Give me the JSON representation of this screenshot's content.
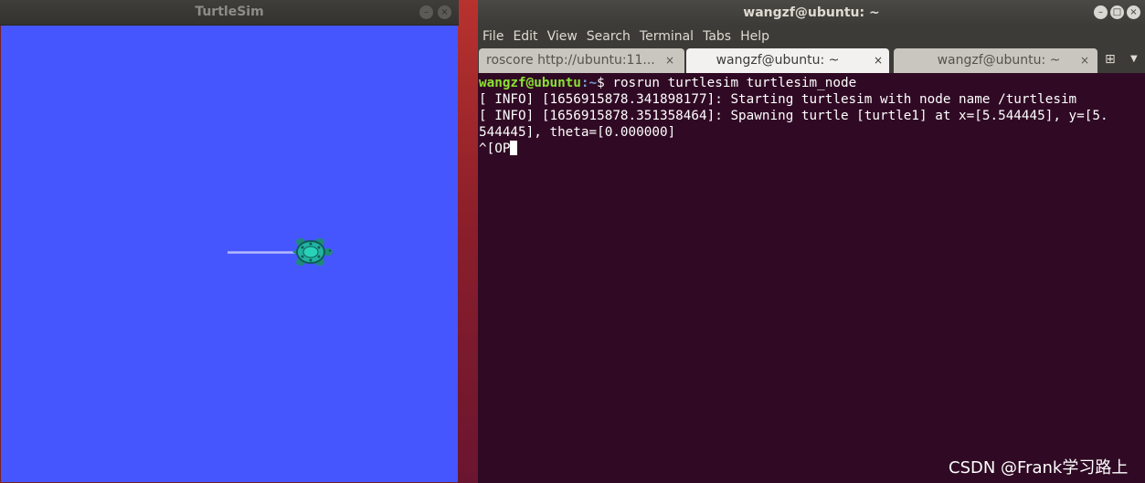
{
  "turtlesim": {
    "title": "TurtleSim",
    "minimize_glyph": "–",
    "close_glyph": "×",
    "background_color": "#4556ff",
    "trail_color": "#b3b8ff"
  },
  "terminal": {
    "title": "wangzf@ubuntu: ~",
    "window_buttons": {
      "minimize": "–",
      "maximize": "□",
      "close": "×"
    },
    "menu": [
      "File",
      "Edit",
      "View",
      "Search",
      "Terminal",
      "Tabs",
      "Help"
    ],
    "tabs": [
      {
        "label": "roscore http://ubuntu:11...",
        "close": "×",
        "active": false
      },
      {
        "label": "wangzf@ubuntu: ~",
        "close": "×",
        "active": true
      },
      {
        "label": "wangzf@ubuntu: ~",
        "close": "×",
        "active": false
      }
    ],
    "new_tab_icon": "⊞",
    "tab_menu_icon": "▼",
    "prompt_user": "wangzf@ubuntu",
    "prompt_path": ":~",
    "prompt_symbol": "$ ",
    "command": "rosrun turtlesim turtlesim_node",
    "output": [
      "[ INFO] [1656915878.341898177]: Starting turtlesim with node name /turtlesim",
      "[ INFO] [1656915878.351358464]: Spawning turtle [turtle1] at x=[5.544445], y=[5.",
      "544445], theta=[0.000000]"
    ],
    "current_input": "^[OP"
  },
  "watermark": "CSDN @Frank学习路上"
}
